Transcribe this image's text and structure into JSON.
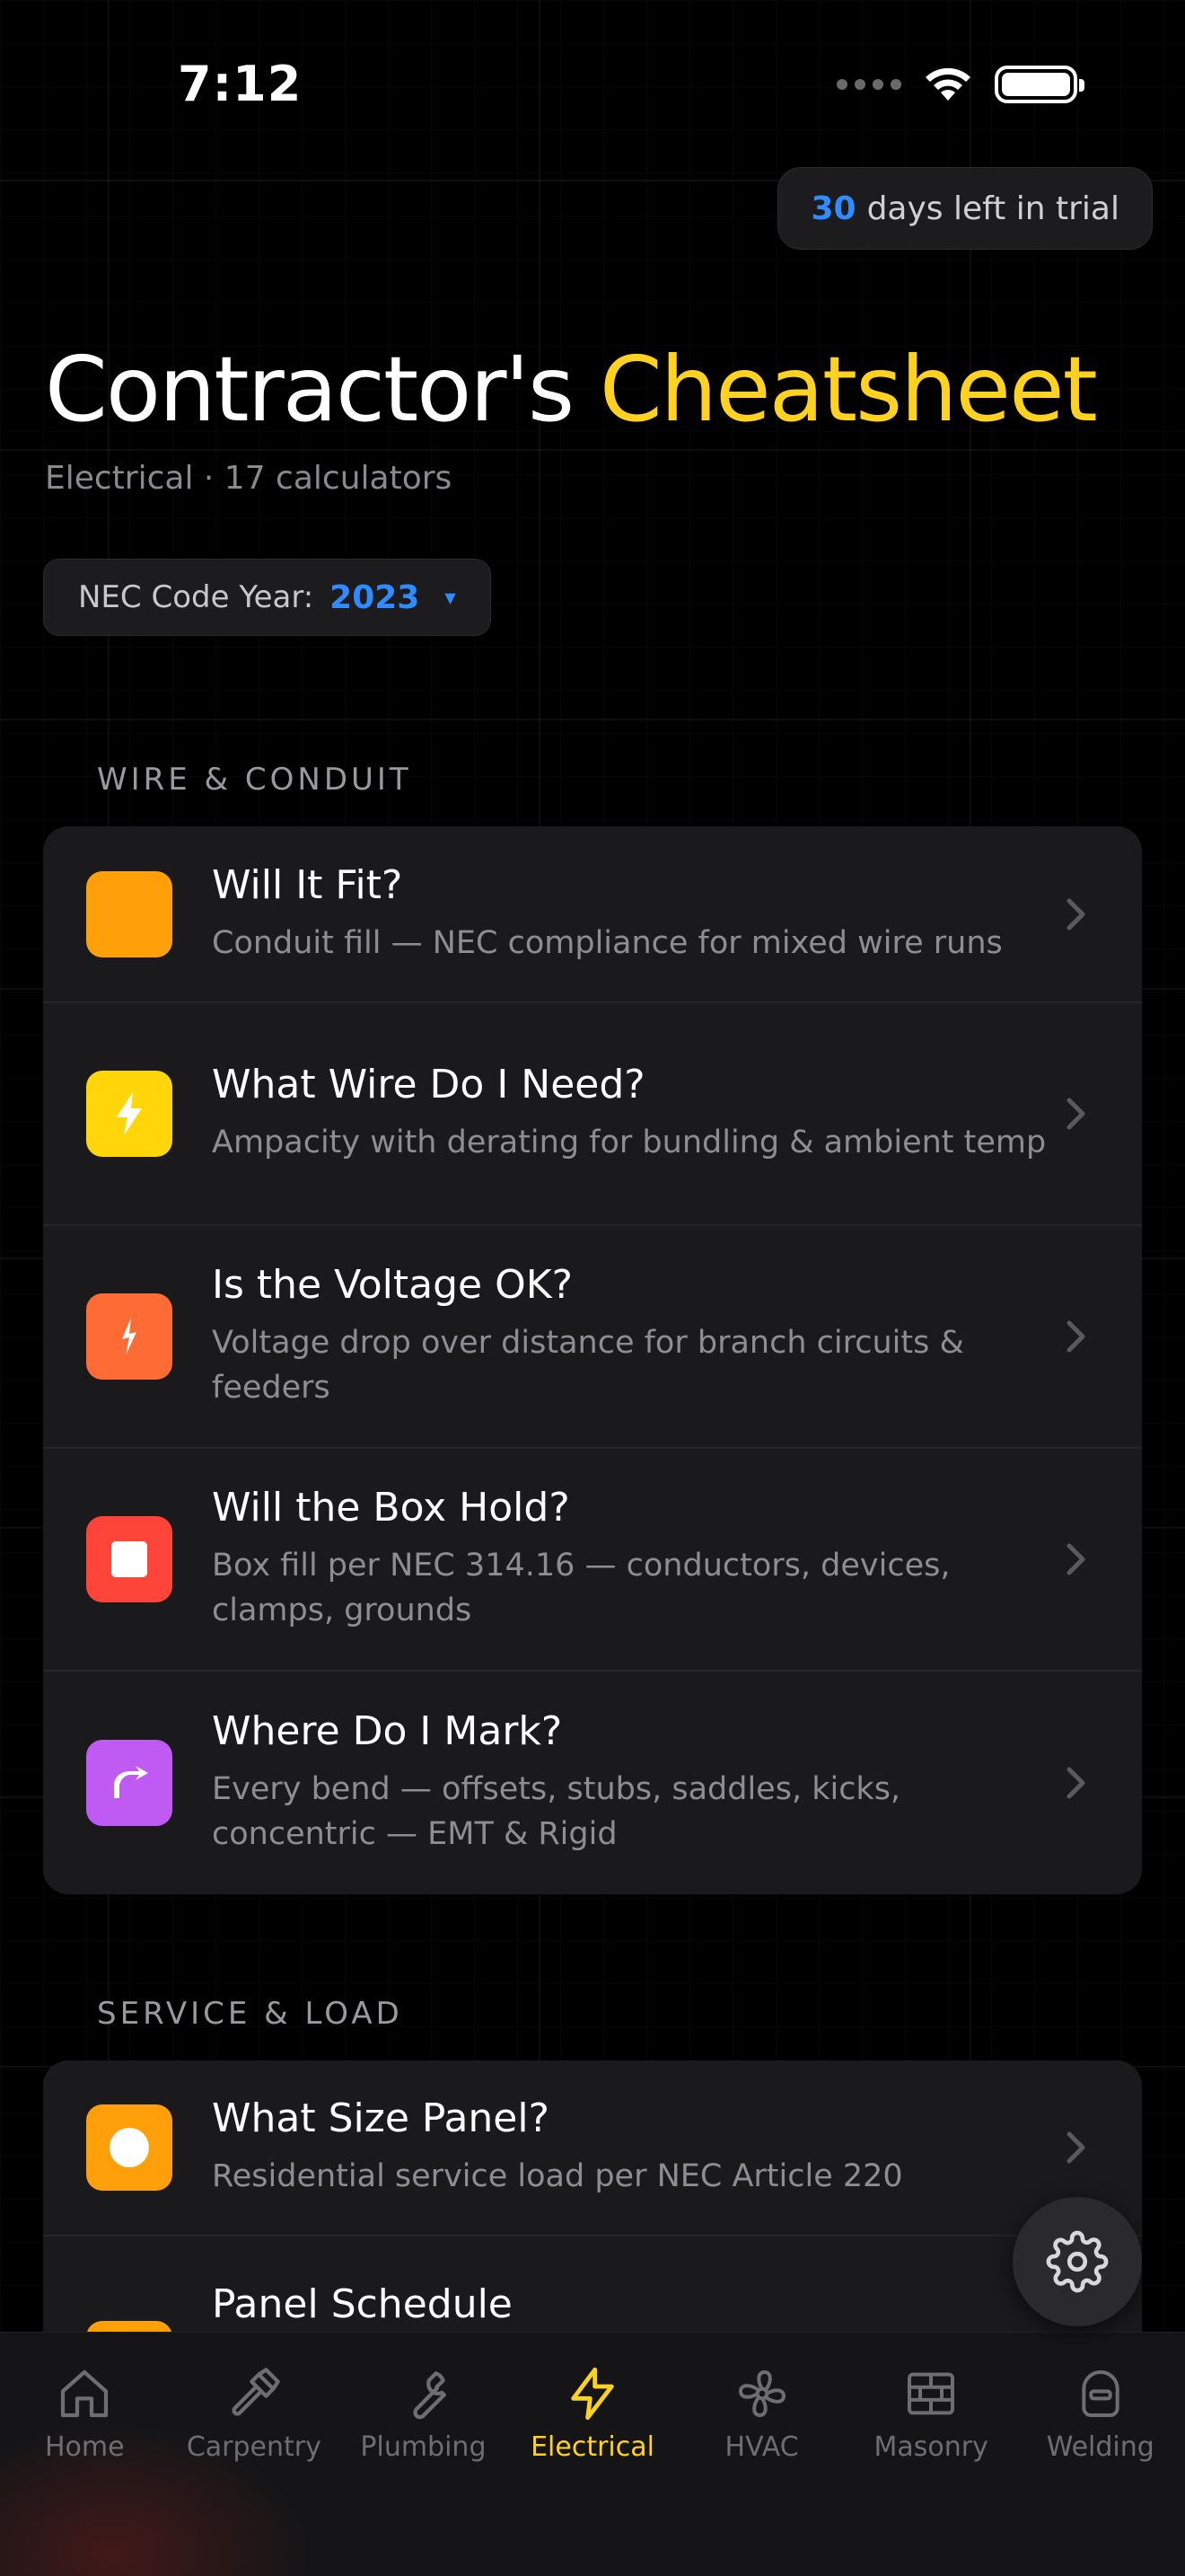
{
  "status": {
    "time": "7:12"
  },
  "trial": {
    "days": "30",
    "text": "days left in trial"
  },
  "header": {
    "title_main": "Contractor's",
    "title_accent": "Cheatsheet",
    "subtitle": "Electrical · 17 calculators"
  },
  "code_year": {
    "label": "NEC Code Year:",
    "value": "2023"
  },
  "sections": [
    {
      "title": "WIRE & CONDUIT",
      "items": [
        {
          "title": "Will It Fit?",
          "desc": "Conduit fill — NEC compliance for mixed wire runs",
          "icon": "square-icon",
          "color": "#ff9f0a"
        },
        {
          "title": "What Wire Do I Need?",
          "desc": "Ampacity with derating for bundling & ambient temp",
          "icon": "bolt-icon",
          "color": "#ffd60a"
        },
        {
          "title": "Is the Voltage OK?",
          "desc": "Voltage drop over distance for branch circuits & feeders",
          "icon": "spark-icon",
          "color": "#ff6b35"
        },
        {
          "title": "Will the Box Hold?",
          "desc": "Box fill per NEC 314.16 — conductors, devices, clamps, grounds",
          "icon": "box-icon",
          "color": "#ff453a"
        },
        {
          "title": "Where Do I Mark?",
          "desc": "Every bend — offsets, stubs, saddles, kicks, concentric — EMT & Rigid",
          "icon": "bend-icon",
          "color": "#bf5af2"
        }
      ]
    },
    {
      "title": "SERVICE & LOAD",
      "items": [
        {
          "title": "What Size Panel?",
          "desc": "Residential service load per NEC Article 220",
          "icon": "circle-icon",
          "color": "#ff9f0a"
        },
        {
          "title": "Panel Schedule",
          "desc": "",
          "icon": "panel-icon",
          "color": "#ff9f0a"
        }
      ]
    }
  ],
  "tabs": [
    {
      "label": "Home",
      "icon": "home-icon",
      "active": false
    },
    {
      "label": "Carpentry",
      "icon": "hammer-icon",
      "active": false
    },
    {
      "label": "Plumbing",
      "icon": "wrench-icon",
      "active": false
    },
    {
      "label": "Electrical",
      "icon": "bolt-icon",
      "active": true
    },
    {
      "label": "HVAC",
      "icon": "fan-icon",
      "active": false
    },
    {
      "label": "Masonry",
      "icon": "brick-icon",
      "active": false
    },
    {
      "label": "Welding",
      "icon": "welding-mask-icon",
      "active": false
    }
  ],
  "colors": {
    "accent": "#ffd21f",
    "link": "#2f8cff",
    "card": "#1a1a1c"
  }
}
